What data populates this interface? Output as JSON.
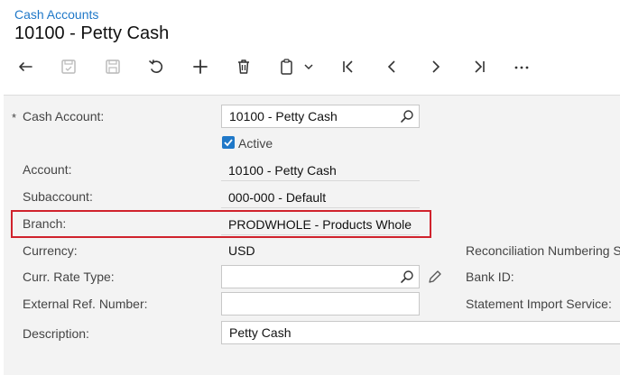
{
  "breadcrumb": "Cash Accounts",
  "title": "10100 - Petty Cash",
  "toolbar": {
    "icons": [
      "back-icon",
      "save-close-icon",
      "save-icon",
      "undo-icon",
      "add-icon",
      "delete-icon",
      "copy-paste-icon",
      "chevron-down-icon",
      "first-record-icon",
      "previous-record-icon",
      "next-record-icon",
      "last-record-icon",
      "more-icon"
    ]
  },
  "form": {
    "required_marker": "*",
    "cash_account": {
      "label": "Cash Account:",
      "value": "10100 - Petty Cash"
    },
    "active": {
      "label": "Active",
      "checked": true
    },
    "account": {
      "label": "Account:",
      "value": "10100 - Petty Cash"
    },
    "subaccount": {
      "label": "Subaccount:",
      "value": "000-000 - Default"
    },
    "branch": {
      "label": "Branch:",
      "value": "PRODWHOLE - Products Whole"
    },
    "currency": {
      "label": "Currency:",
      "value": "USD"
    },
    "curr_rate_type": {
      "label": "Curr. Rate Type:",
      "value": ""
    },
    "external_ref": {
      "label": "External Ref. Number:",
      "value": ""
    },
    "description": {
      "label": "Description:",
      "value": "Petty Cash"
    }
  },
  "right_labels": {
    "reconciliation": "Reconciliation Numbering S",
    "bank_id": "Bank ID:",
    "statement_import": "Statement Import Service:"
  },
  "colors": {
    "link": "#1f78c8",
    "highlight": "#d0222c",
    "panel": "#f3f3f3"
  }
}
